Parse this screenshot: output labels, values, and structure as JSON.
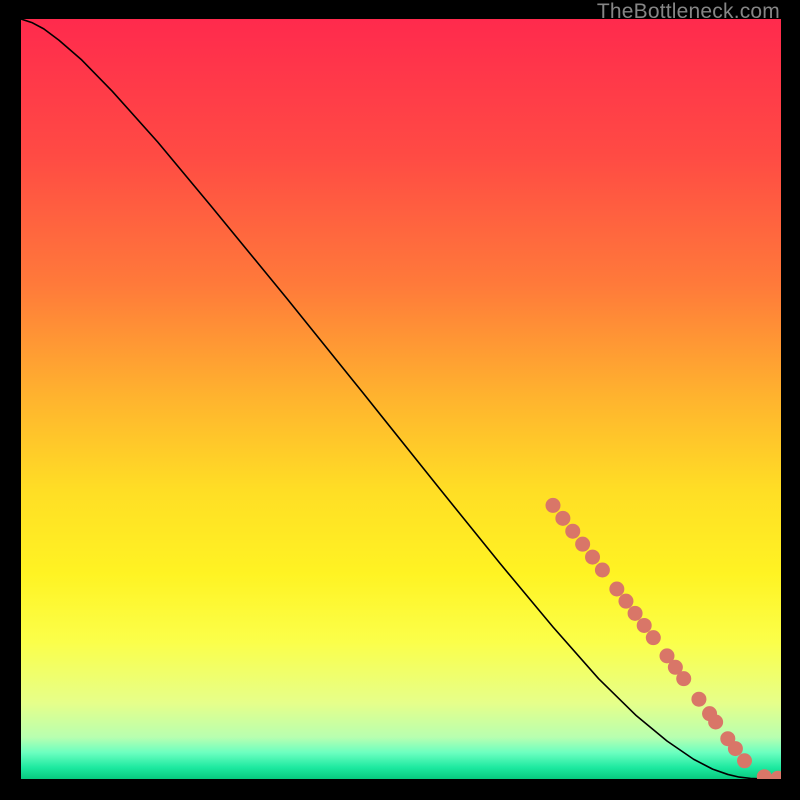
{
  "watermark": "TheBottleneck.com",
  "chart_data": {
    "type": "line",
    "xlim": [
      0,
      100
    ],
    "ylim": [
      0,
      100
    ],
    "title": "",
    "xlabel": "",
    "ylabel": "",
    "background_gradient": {
      "stops": [
        {
          "t": 0.0,
          "color": "#ff2a4d"
        },
        {
          "t": 0.18,
          "color": "#ff4b44"
        },
        {
          "t": 0.35,
          "color": "#ff7a3a"
        },
        {
          "t": 0.5,
          "color": "#ffb42e"
        },
        {
          "t": 0.62,
          "color": "#ffde25"
        },
        {
          "t": 0.73,
          "color": "#fff323"
        },
        {
          "t": 0.82,
          "color": "#fbff4a"
        },
        {
          "t": 0.9,
          "color": "#e6ff8a"
        },
        {
          "t": 0.945,
          "color": "#b8ffb0"
        },
        {
          "t": 0.965,
          "color": "#6dffc0"
        },
        {
          "t": 0.985,
          "color": "#1de9a0"
        },
        {
          "t": 1.0,
          "color": "#07c97e"
        }
      ]
    },
    "series": [
      {
        "name": "curve",
        "stroke": "#000000",
        "stroke_width": 1.6,
        "x": [
          0.0,
          1.5,
          3.0,
          5.0,
          8.0,
          12.0,
          18.0,
          25.0,
          35.0,
          45.0,
          55.0,
          63.0,
          70.0,
          76.0,
          81.0,
          85.0,
          88.5,
          91.0,
          93.0,
          94.5,
          96.0,
          98.0,
          100.0
        ],
        "y": [
          100.0,
          99.5,
          98.7,
          97.2,
          94.6,
          90.5,
          83.8,
          75.4,
          63.2,
          50.8,
          38.3,
          28.4,
          20.0,
          13.2,
          8.3,
          5.0,
          2.6,
          1.3,
          0.6,
          0.25,
          0.08,
          0.0,
          0.0
        ]
      }
    ],
    "markers": {
      "name": "dots",
      "color": "#d97668",
      "radius": 7.5,
      "points": [
        {
          "x": 70.0,
          "y": 36.0
        },
        {
          "x": 71.3,
          "y": 34.3
        },
        {
          "x": 72.6,
          "y": 32.6
        },
        {
          "x": 73.9,
          "y": 30.9
        },
        {
          "x": 75.2,
          "y": 29.2
        },
        {
          "x": 76.5,
          "y": 27.5
        },
        {
          "x": 78.4,
          "y": 25.0
        },
        {
          "x": 79.6,
          "y": 23.4
        },
        {
          "x": 80.8,
          "y": 21.8
        },
        {
          "x": 82.0,
          "y": 20.2
        },
        {
          "x": 83.2,
          "y": 18.6
        },
        {
          "x": 85.0,
          "y": 16.2
        },
        {
          "x": 86.1,
          "y": 14.7
        },
        {
          "x": 87.2,
          "y": 13.2
        },
        {
          "x": 89.2,
          "y": 10.5
        },
        {
          "x": 90.6,
          "y": 8.6
        },
        {
          "x": 91.4,
          "y": 7.5
        },
        {
          "x": 93.0,
          "y": 5.3
        },
        {
          "x": 94.0,
          "y": 4.0
        },
        {
          "x": 95.2,
          "y": 2.4
        },
        {
          "x": 97.8,
          "y": 0.3
        },
        {
          "x": 99.6,
          "y": 0.1
        },
        {
          "x": 100.5,
          "y": 0.1
        }
      ]
    }
  }
}
